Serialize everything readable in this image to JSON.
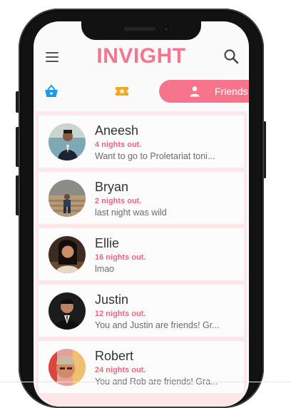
{
  "header": {
    "title": "INVIGHT"
  },
  "tabs": {
    "friends_label": "Friends"
  },
  "friends": [
    {
      "name": "Aneesh",
      "nights": "4 nights out.",
      "message": "Want to go to Proletariat toni..."
    },
    {
      "name": "Bryan",
      "nights": "2 nights out.",
      "message": "last night was wild"
    },
    {
      "name": "Ellie",
      "nights": "16 nights out.",
      "message": "lmao"
    },
    {
      "name": "Justin",
      "nights": "12 nights out.",
      "message": "You and Justin are friends! Gr..."
    },
    {
      "name": "Robert",
      "nights": "24 nights out.",
      "message": "You and Rob are friends! Gra..."
    }
  ],
  "colors": {
    "accent": "#f6758c",
    "list_bg": "#fde7ea",
    "basket": "#1e9be8",
    "ticket": "#f5a623"
  }
}
